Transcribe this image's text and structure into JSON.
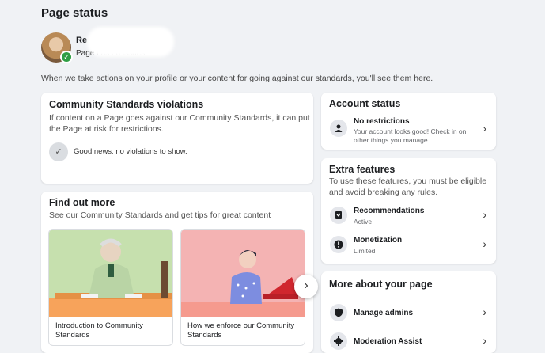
{
  "header": {
    "title": "Page status",
    "page_name": "Re",
    "page_issues": "Page has no issues",
    "intro": "When we take actions on your profile or your content for going against our standards, you'll see them here."
  },
  "violations": {
    "title": "Community Standards violations",
    "subtitle": "If content on a Page goes against our Community Standards, it can put the Page at risk for restrictions.",
    "status": "Good news: no violations to show."
  },
  "find_out_more": {
    "title": "Find out more",
    "subtitle": "See our Community Standards and get tips for great content",
    "cards": [
      {
        "caption": "Introduction to Community Standards"
      },
      {
        "caption": "How we enforce our Community Standards"
      }
    ]
  },
  "account_status": {
    "title": "Account status",
    "row_title": "No restrictions",
    "row_sub": "Your account looks good! Check in on other things you manage."
  },
  "extra_features": {
    "title": "Extra features",
    "subtitle": "To use these features, you must be eligible and avoid breaking any rules.",
    "items": [
      {
        "label": "Recommendations",
        "status": "Active"
      },
      {
        "label": "Monetization",
        "status": "Limited"
      }
    ]
  },
  "more_about": {
    "title": "More about your page",
    "items": [
      {
        "label": "Manage admins"
      },
      {
        "label": "Moderation Assist"
      }
    ]
  },
  "icons": {
    "check": "check-icon",
    "person": "person-icon",
    "recommendations": "recommendations-icon",
    "monetization": "alert-icon",
    "admins": "shield-icon",
    "moderation": "gear-icon",
    "chevron": "chevron-right-icon"
  }
}
